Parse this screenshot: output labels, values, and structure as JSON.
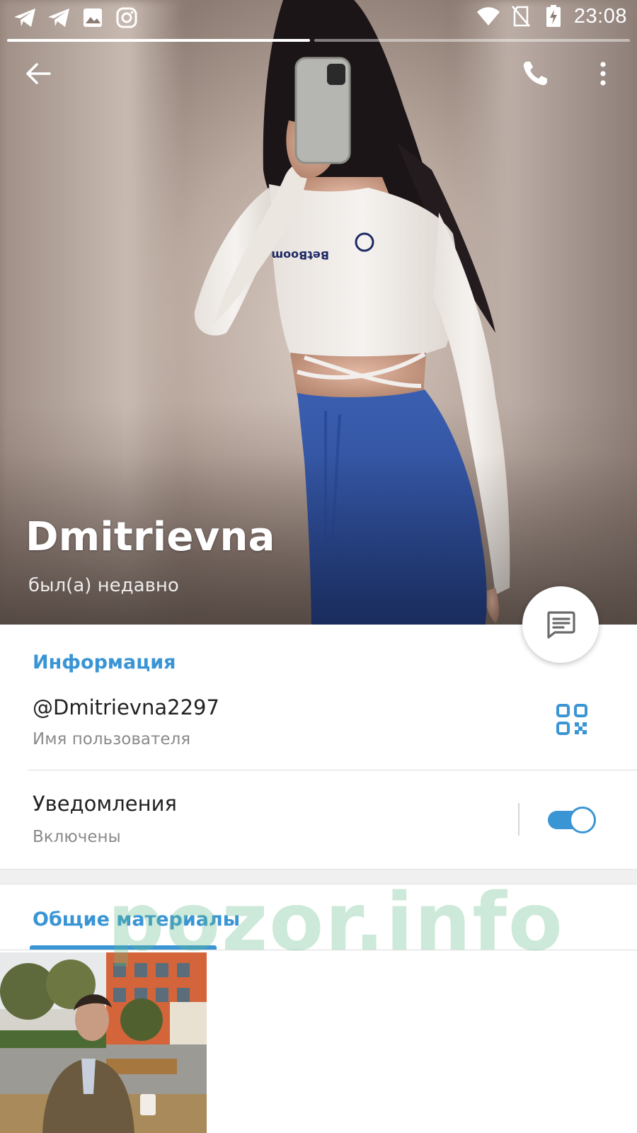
{
  "status_bar": {
    "time": "23:08",
    "left_icons": [
      "telegram-icon",
      "telegram-icon",
      "image-icon",
      "instagram-icon"
    ],
    "right_icons": [
      "wifi-icon",
      "no-sim-icon",
      "battery-charging-icon"
    ]
  },
  "story_progress": {
    "segments": 2,
    "active_segment": 1
  },
  "toolbar": {
    "back_icon": "arrow-left-icon",
    "call_icon": "phone-icon",
    "menu_icon": "more-vertical-icon"
  },
  "profile": {
    "name": "Dmitrievna",
    "status": "был(а) недавно"
  },
  "fab": {
    "icon": "message-icon"
  },
  "info": {
    "title": "Информация",
    "username": "@Dmitrievna2297",
    "username_label": "Имя пользователя",
    "qr_icon": "qr-code-icon",
    "notifications_title": "Уведомления",
    "notifications_state": "Включены",
    "notifications_enabled": true
  },
  "shared_media": {
    "title": "Общие материалы",
    "items": [
      "photo-thumbnail"
    ]
  },
  "watermark": "pozor.info",
  "colors": {
    "accent": "#3a95d5",
    "watermark": "#60ba8a"
  }
}
